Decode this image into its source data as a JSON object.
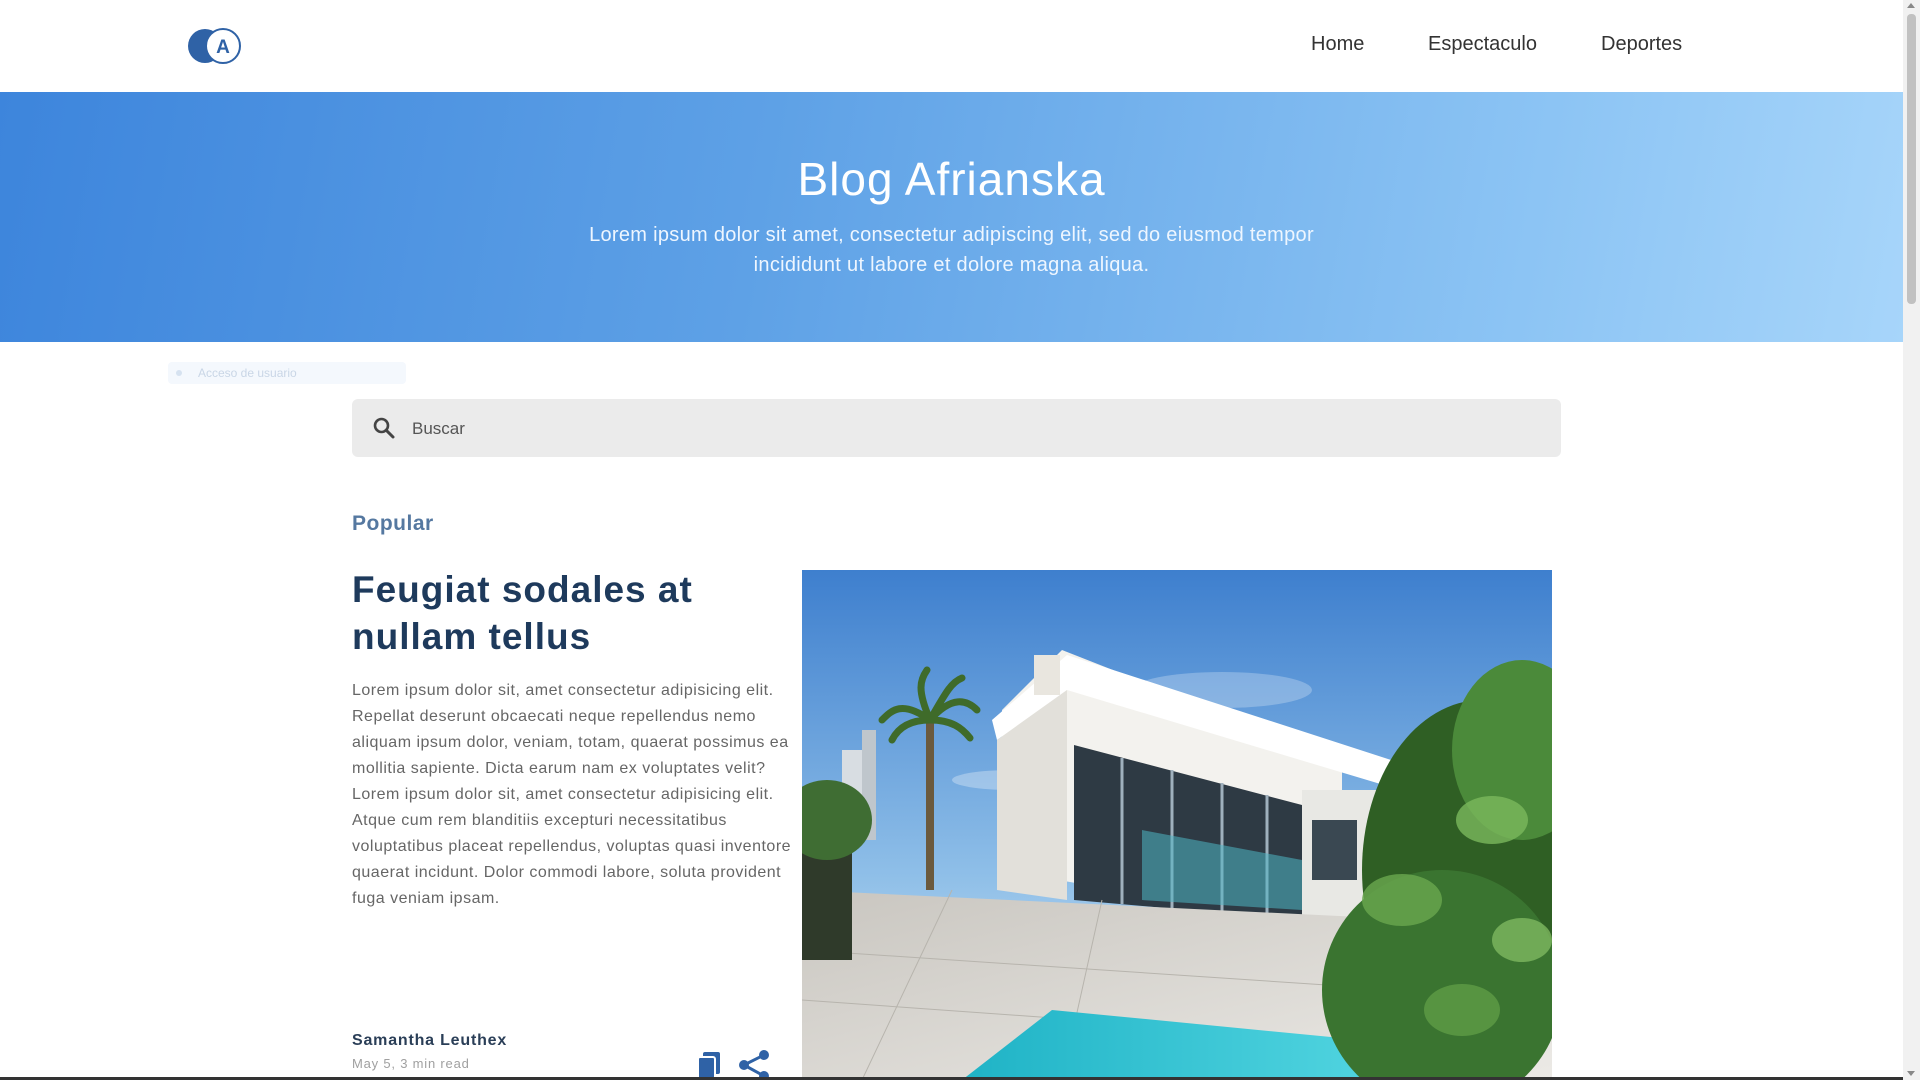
{
  "header": {
    "nav": [
      {
        "label": "Home"
      },
      {
        "label": "Espectaculo"
      },
      {
        "label": "Deportes"
      }
    ],
    "logo_letter": "A"
  },
  "hero": {
    "title": "Blog Afrianska",
    "subtitle": "Lorem ipsum dolor sit amet, consectetur adipiscing elit, sed do eiusmod tempor incididunt ut labore et dolore magna aliqua."
  },
  "hint": {
    "text": "Acceso de usuario"
  },
  "search": {
    "placeholder": "Buscar",
    "value": ""
  },
  "popular": {
    "label": "Popular",
    "post": {
      "title": "Feugiat sodales at nullam tellus",
      "body": "Lorem ipsum dolor sit, amet consectetur adipisicing elit. Repellat deserunt obcaecati neque repellendus nemo aliquam ipsum dolor, veniam, totam, quaerat possimus ea mollitia sapiente. Dicta earum nam ex voluptates velit? Lorem ipsum dolor sit, amet consectetur adipisicing elit. Atque cum rem blanditiis excepturi necessitatibus voluptatibus placeat repellendus, voluptas quasi inventore quaerat incidunt. Dolor commodi labore, soluta provident fuga veniam ipsam.",
      "author": "Samantha Leuthex",
      "meta": "May 5, 3 min read"
    }
  },
  "colors": {
    "accent": "#2a5a9e",
    "hero_start": "#3d85dc",
    "hero_end": "#a7d5fa",
    "title": "#1e3a5c"
  },
  "icons": [
    "logo-icon",
    "search-icon",
    "bookmark-icon",
    "share-icon"
  ]
}
